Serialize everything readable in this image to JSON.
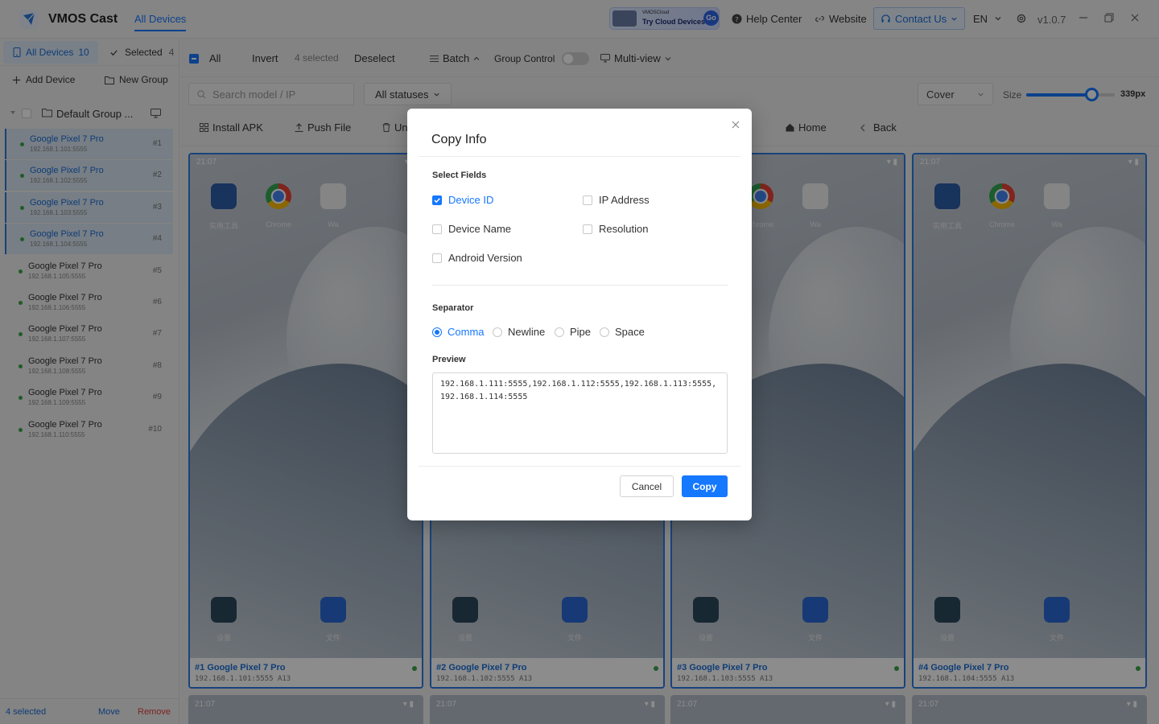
{
  "app": {
    "name": "VMOS Cast",
    "nav_tab": "All Devices",
    "version": "v1.0.7",
    "language": "EN"
  },
  "promo": {
    "small": "VMOSCloud",
    "big": "Try Cloud Devices",
    "go": "Go"
  },
  "header_links": {
    "help": "Help Center",
    "website": "Website",
    "contact": "Contact Us"
  },
  "sidebar": {
    "tab_all": "All Devices",
    "tab_all_count": "10",
    "tab_selected": "Selected",
    "tab_selected_count": "4",
    "add_device": "Add Device",
    "new_group": "New Group",
    "group_name": "Default Group ...",
    "devices": [
      {
        "name": "Google Pixel 7 Pro",
        "ip": "192.168.1.101:5555",
        "idx": "#1",
        "selected": true
      },
      {
        "name": "Google Pixel 7 Pro",
        "ip": "192.168.1.102:5555",
        "idx": "#2",
        "selected": true
      },
      {
        "name": "Google Pixel 7 Pro",
        "ip": "192.168.1.103:5555",
        "idx": "#3",
        "selected": true
      },
      {
        "name": "Google Pixel 7 Pro",
        "ip": "192.168.1.104:5555",
        "idx": "#4",
        "selected": true
      },
      {
        "name": "Google Pixel 7 Pro",
        "ip": "192.168.1.105:5555",
        "idx": "#5",
        "selected": false
      },
      {
        "name": "Google Pixel 7 Pro",
        "ip": "192.168.1.106:5555",
        "idx": "#6",
        "selected": false
      },
      {
        "name": "Google Pixel 7 Pro",
        "ip": "192.168.1.107:5555",
        "idx": "#7",
        "selected": false
      },
      {
        "name": "Google Pixel 7 Pro",
        "ip": "192.168.1.108:5555",
        "idx": "#8",
        "selected": false
      },
      {
        "name": "Google Pixel 7 Pro",
        "ip": "192.168.1.109:5555",
        "idx": "#9",
        "selected": false
      },
      {
        "name": "Google Pixel 7 Pro",
        "ip": "192.168.1.110:5555",
        "idx": "#10",
        "selected": false
      }
    ],
    "footer_selected": "4 selected",
    "footer_move": "Move",
    "footer_remove": "Remove"
  },
  "toolbar": {
    "all": "All",
    "invert": "Invert",
    "selected": "4 selected",
    "deselect": "Deselect",
    "batch": "Batch",
    "group_control": "Group Control",
    "multiview": "Multi-view",
    "search_placeholder": "Search model / IP",
    "status": "All statuses",
    "cover": "Cover",
    "size_label": "Size",
    "size_value": "339px",
    "size_fraction": 0.74,
    "install_apk": "Install APK",
    "push_file": "Push File",
    "uninstall": "Un",
    "home": "Home",
    "back": "Back"
  },
  "cards": [
    {
      "num": "#1",
      "name": "Google Pixel 7 Pro",
      "sub": "192.168.1.101:5555 A13"
    },
    {
      "num": "#2",
      "name": "Google Pixel 7 Pro",
      "sub": "192.168.1.102:5555 A13"
    },
    {
      "num": "#3",
      "name": "Google Pixel 7 Pro",
      "sub": "192.168.1.103:5555 A13"
    },
    {
      "num": "#4",
      "name": "Google Pixel 7 Pro",
      "sub": "192.168.1.104:5555 A13"
    }
  ],
  "phone": {
    "time": "21:07",
    "app_tools": "实用工具",
    "app_chrome": "Chrome",
    "app_wa": "Wa",
    "app_settings": "设置",
    "app_files": "文件"
  },
  "modal": {
    "title": "Copy Info",
    "select_fields": "Select Fields",
    "fields": {
      "device_id": "Device ID",
      "ip_address": "IP Address",
      "device_name": "Device Name",
      "resolution": "Resolution",
      "android_version": "Android Version"
    },
    "separator_label": "Separator",
    "separators": {
      "comma": "Comma",
      "newline": "Newline",
      "pipe": "Pipe",
      "space": "Space"
    },
    "preview_label": "Preview",
    "preview_text": "192.168.1.111:5555,192.168.1.112:5555,192.168.1.113:5555,192.168.1.114:5555",
    "cancel": "Cancel",
    "copy": "Copy"
  },
  "colors": {
    "accent": "#1677ff",
    "online": "#3aa648",
    "danger": "#e0443c"
  }
}
